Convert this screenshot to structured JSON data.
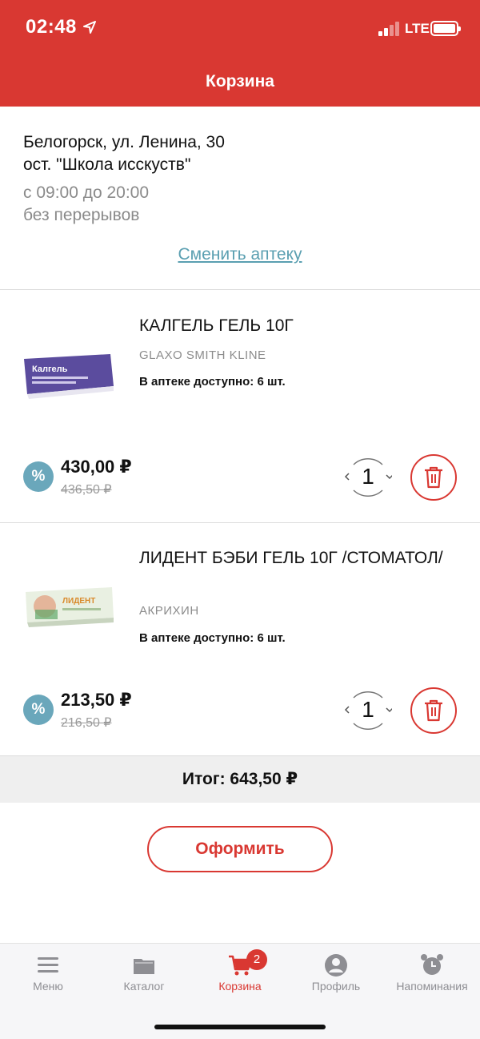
{
  "status_bar": {
    "time": "02:48",
    "network": "LTE"
  },
  "header": {
    "title": "Корзина"
  },
  "store": {
    "address_line1": "Белогорск, ул. Ленина, 30",
    "address_line2": "ост. \"Школа исскуств\"",
    "hours": "с 09:00 до 20:00",
    "break": "без перерывов",
    "change_link": "Сменить аптеку"
  },
  "items": [
    {
      "name": "КАЛГЕЛЬ ГЕЛЬ 10Г",
      "maker": "GLAXO SMITH KLINE",
      "stock": "В аптеке доступно: 6 шт.",
      "discount_icon": "%",
      "price": "430,00 ₽",
      "old_price": "436,50 ₽",
      "quantity": "1",
      "image_text": "Калгель"
    },
    {
      "name": "ЛИДЕНТ БЭБИ ГЕЛЬ 10Г /СТОМАТОЛ/",
      "maker": "АКРИХИН",
      "stock": "В аптеке доступно: 6 шт.",
      "discount_icon": "%",
      "price": "213,50 ₽",
      "old_price": "216,50 ₽",
      "quantity": "1",
      "image_text": "ЛИДЕНТ"
    }
  ],
  "summary": {
    "total": "Итог: 643,50 ₽",
    "checkout_label": "Оформить"
  },
  "tabbar": {
    "tabs": [
      {
        "label": "Меню",
        "icon": "menu-icon"
      },
      {
        "label": "Каталог",
        "icon": "folder-icon"
      },
      {
        "label": "Корзина",
        "icon": "cart-icon",
        "active": true
      },
      {
        "label": "Профиль",
        "icon": "profile-icon"
      },
      {
        "label": "Напоминания",
        "icon": "alarm-clock-icon"
      }
    ],
    "cart_badge": "2"
  },
  "colors": {
    "accent": "#d93832",
    "discount": "#6aa7bb",
    "link": "#5a9fb1"
  }
}
